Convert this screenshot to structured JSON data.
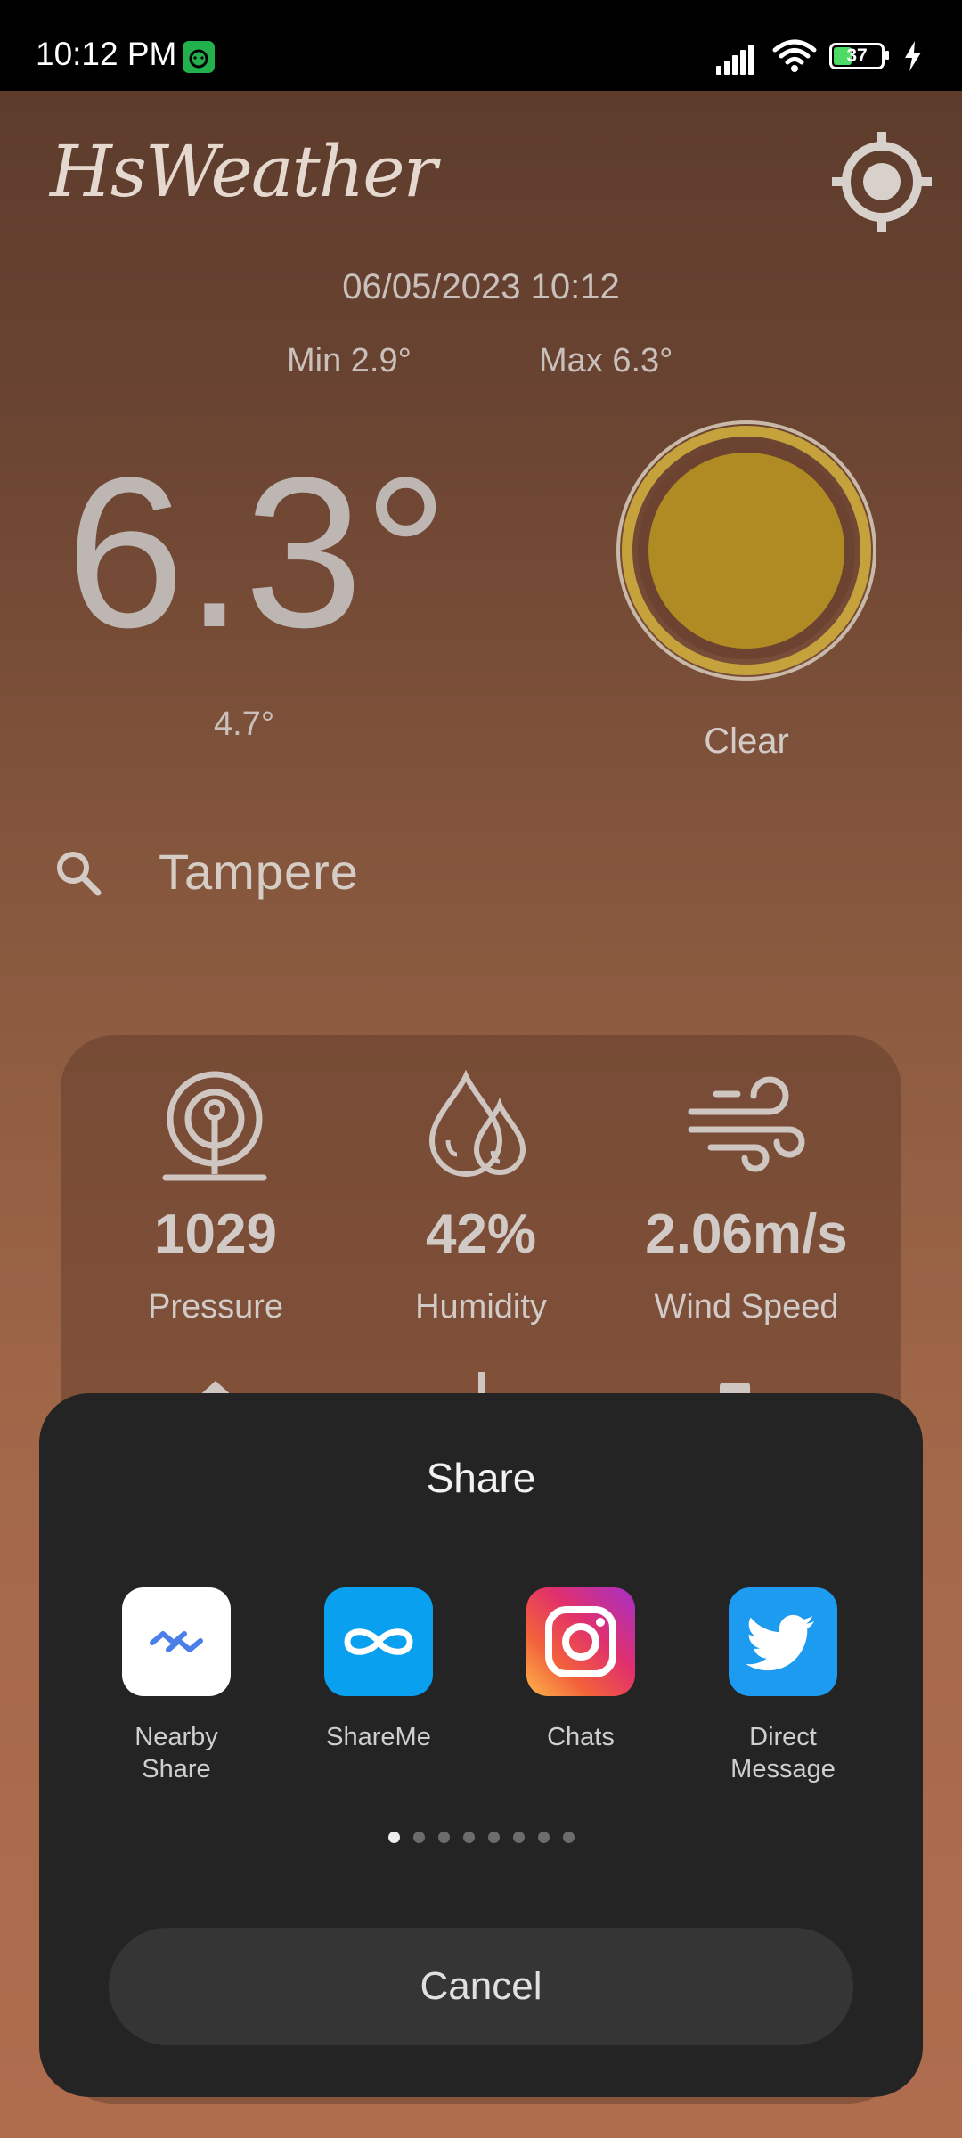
{
  "status_bar": {
    "time": "10:12 PM",
    "battery_level": "37",
    "icons": [
      "android-app-icon",
      "signal-icon",
      "wifi-icon",
      "battery-icon",
      "charging-icon"
    ]
  },
  "app": {
    "logo": "HsWeather",
    "datetime": "06/05/2023 10:12",
    "min_temp": "Min 2.9°",
    "max_temp": "Max 6.3°",
    "temperature": "6.3°",
    "feels_like": "4.7°",
    "condition": "Clear",
    "city": "Tampere",
    "condition_icon": "sun-icon",
    "sun_color": "#b08a22"
  },
  "details": {
    "stats": [
      {
        "value": "1029",
        "label": "Pressure",
        "icon": "pressure-icon"
      },
      {
        "value": "42%",
        "label": "Humidity",
        "icon": "humidity-icon"
      },
      {
        "value": "2.06m/s",
        "label": "Wind Speed",
        "icon": "wind-icon"
      }
    ]
  },
  "share_sheet": {
    "title": "Share",
    "targets": [
      {
        "label": "Nearby\nShare",
        "icon": "nearby-share-icon",
        "color": "#ffffff"
      },
      {
        "label": "ShareMe",
        "icon": "shareme-icon",
        "color": "#0aa0f0"
      },
      {
        "label": "Chats",
        "icon": "instagram-icon",
        "color": "#e1306c"
      },
      {
        "label": "Direct\nMessage",
        "icon": "twitter-icon",
        "color": "#1d9bf0"
      }
    ],
    "page_count": 8,
    "active_page": 1,
    "cancel_label": "Cancel"
  }
}
